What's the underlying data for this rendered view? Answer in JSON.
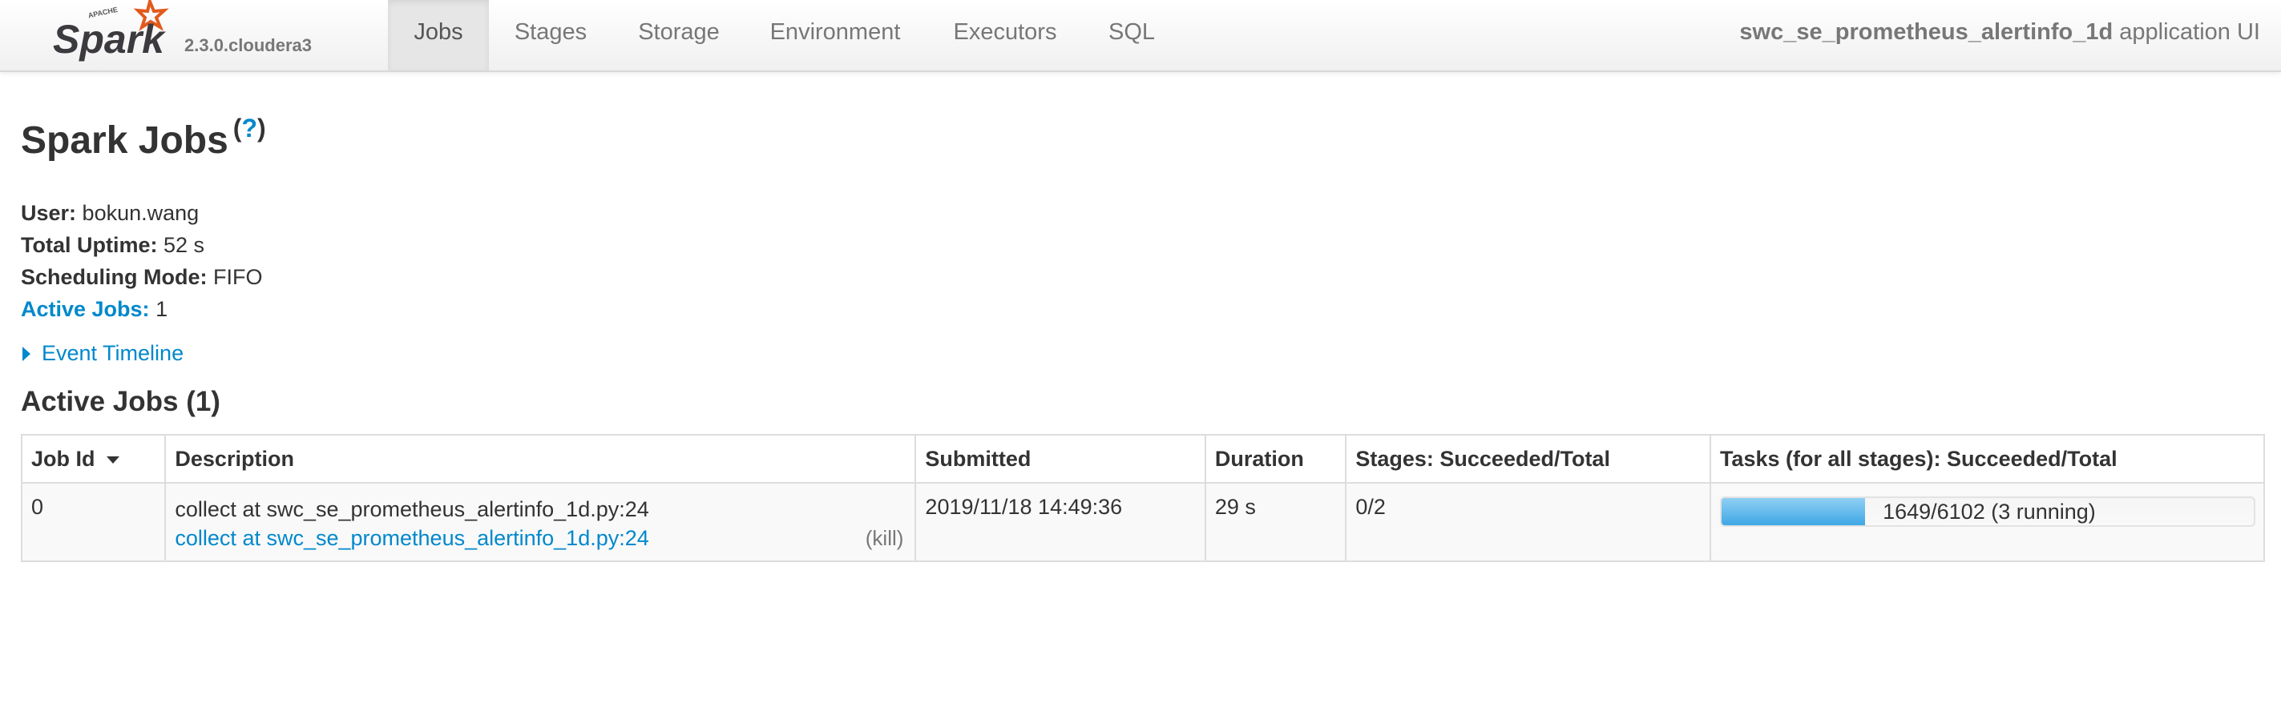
{
  "brand": {
    "apache_label": "APACHE",
    "logo_text": "Spark",
    "version": "2.3.0.cloudera3",
    "accent_color": "#e25a1c"
  },
  "nav": {
    "tabs": [
      {
        "label": "Jobs",
        "active": true
      },
      {
        "label": "Stages",
        "active": false
      },
      {
        "label": "Storage",
        "active": false
      },
      {
        "label": "Environment",
        "active": false
      },
      {
        "label": "Executors",
        "active": false
      },
      {
        "label": "SQL",
        "active": false
      }
    ],
    "app_name": "swc_se_prometheus_alertinfo_1d",
    "app_suffix": " application UI"
  },
  "page": {
    "title": "Spark Jobs",
    "help_label": "?",
    "help_open": "(",
    "help_close": ")"
  },
  "summary": {
    "user_label": "User:",
    "user_value": "bokun.wang",
    "uptime_label": "Total Uptime:",
    "uptime_value": "52 s",
    "scheduling_label": "Scheduling Mode:",
    "scheduling_value": "FIFO",
    "active_jobs_label": "Active Jobs:",
    "active_jobs_value": "1"
  },
  "timeline": {
    "label": "Event Timeline",
    "icon": "caret-right-icon"
  },
  "active_jobs": {
    "title": "Active Jobs (1)",
    "columns": [
      "Job Id",
      "Description",
      "Submitted",
      "Duration",
      "Stages: Succeeded/Total",
      "Tasks (for all stages): Succeeded/Total"
    ],
    "rows": [
      {
        "job_id": "0",
        "description": "collect at swc_se_prometheus_alertinfo_1d.py:24",
        "description_link": "collect at swc_se_prometheus_alertinfo_1d.py:24",
        "kill_label": "(kill)",
        "submitted": "2019/11/18 14:49:36",
        "duration": "29 s",
        "stages": "0/2",
        "tasks_text": "1649/6102 (3 running)",
        "tasks_succeeded": 1649,
        "tasks_total": 6102
      }
    ]
  },
  "colors": {
    "link": "#0088cc",
    "progress": "#3ea7e4"
  }
}
